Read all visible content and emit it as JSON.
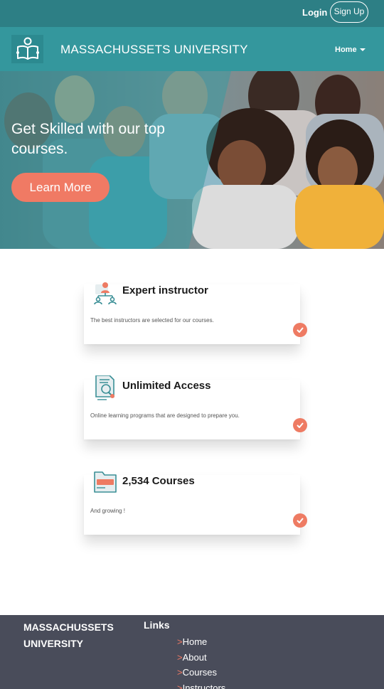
{
  "topbar": {
    "login": "Login",
    "signup": "Sign Up"
  },
  "navbar": {
    "brand": "MASSACHUSSETS UNIVERSITY",
    "home_menu": "Home",
    "logo_icon": "open-book-reader-icon"
  },
  "hero": {
    "title": "Get Skilled with our top courses.",
    "cta": "Learn More"
  },
  "features": [
    {
      "title": "Expert instructor",
      "description": "The best instructors are selected for our courses.",
      "icon": "instructor-icon"
    },
    {
      "title": "Unlimited Access",
      "description": "Online learning programs that are designed to prepare you.",
      "icon": "certificate-icon"
    },
    {
      "title": "2,534 Courses",
      "description": "And growing !",
      "icon": "folder-icon"
    }
  ],
  "footer": {
    "brand": "MASSACHUSSETS UNIVERSITY",
    "links_heading": "Links",
    "link_marker": ">",
    "links": [
      "Home",
      "About",
      "Courses",
      "Instructors"
    ]
  },
  "colors": {
    "topbar": "#2d7f85",
    "navbar": "#34979d",
    "accent": "#f07a64",
    "footer": "#494c5a"
  }
}
